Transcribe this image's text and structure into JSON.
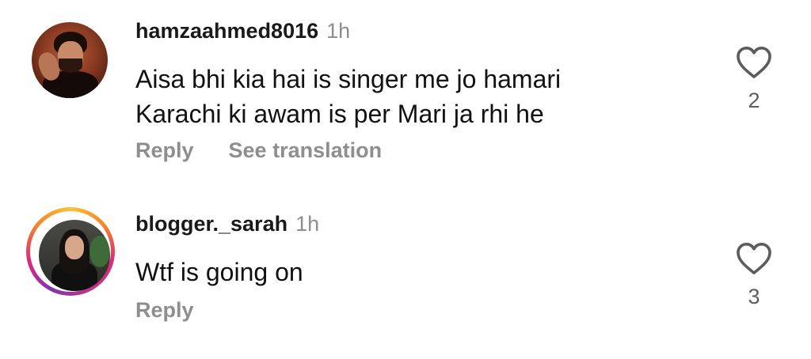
{
  "comments": [
    {
      "username": "hamzaahmed8016",
      "time": "1h",
      "text_lines": [
        "Aisa bhi kia hai is singer me jo hamari",
        "Karachi ki awam is per Mari ja rhi he"
      ],
      "actions": [
        "Reply",
        "See translation"
      ],
      "like_count": "2",
      "has_story_ring": false,
      "like_icon": "heart-outline-icon"
    },
    {
      "username": "blogger._sarah",
      "time": "1h",
      "text_lines": [
        "Wtf is going on"
      ],
      "actions": [
        "Reply"
      ],
      "like_count": "3",
      "has_story_ring": true,
      "like_icon": "heart-outline-icon"
    }
  ],
  "colors": {
    "text": "#111111",
    "muted": "#8e8e8e",
    "story_ring": [
      "#f9c13b",
      "#f58529",
      "#dd2a7b",
      "#8134af"
    ]
  }
}
